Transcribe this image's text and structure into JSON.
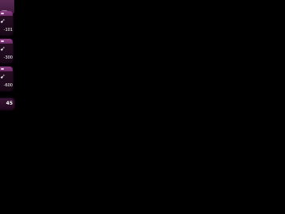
{
  "sidebar": {
    "cards": [
      {
        "icon": "arrow-cursor-icon",
        "label": "-101"
      },
      {
        "icon": "arrow-cursor-icon",
        "label": "-300"
      },
      {
        "icon": "arrow-cursor-icon",
        "label": "-600"
      }
    ],
    "counter": "45"
  },
  "colors": {
    "background": "#000000",
    "panel": "#3f1a3c",
    "band": "#8a3d82",
    "text": "#ffffff"
  }
}
